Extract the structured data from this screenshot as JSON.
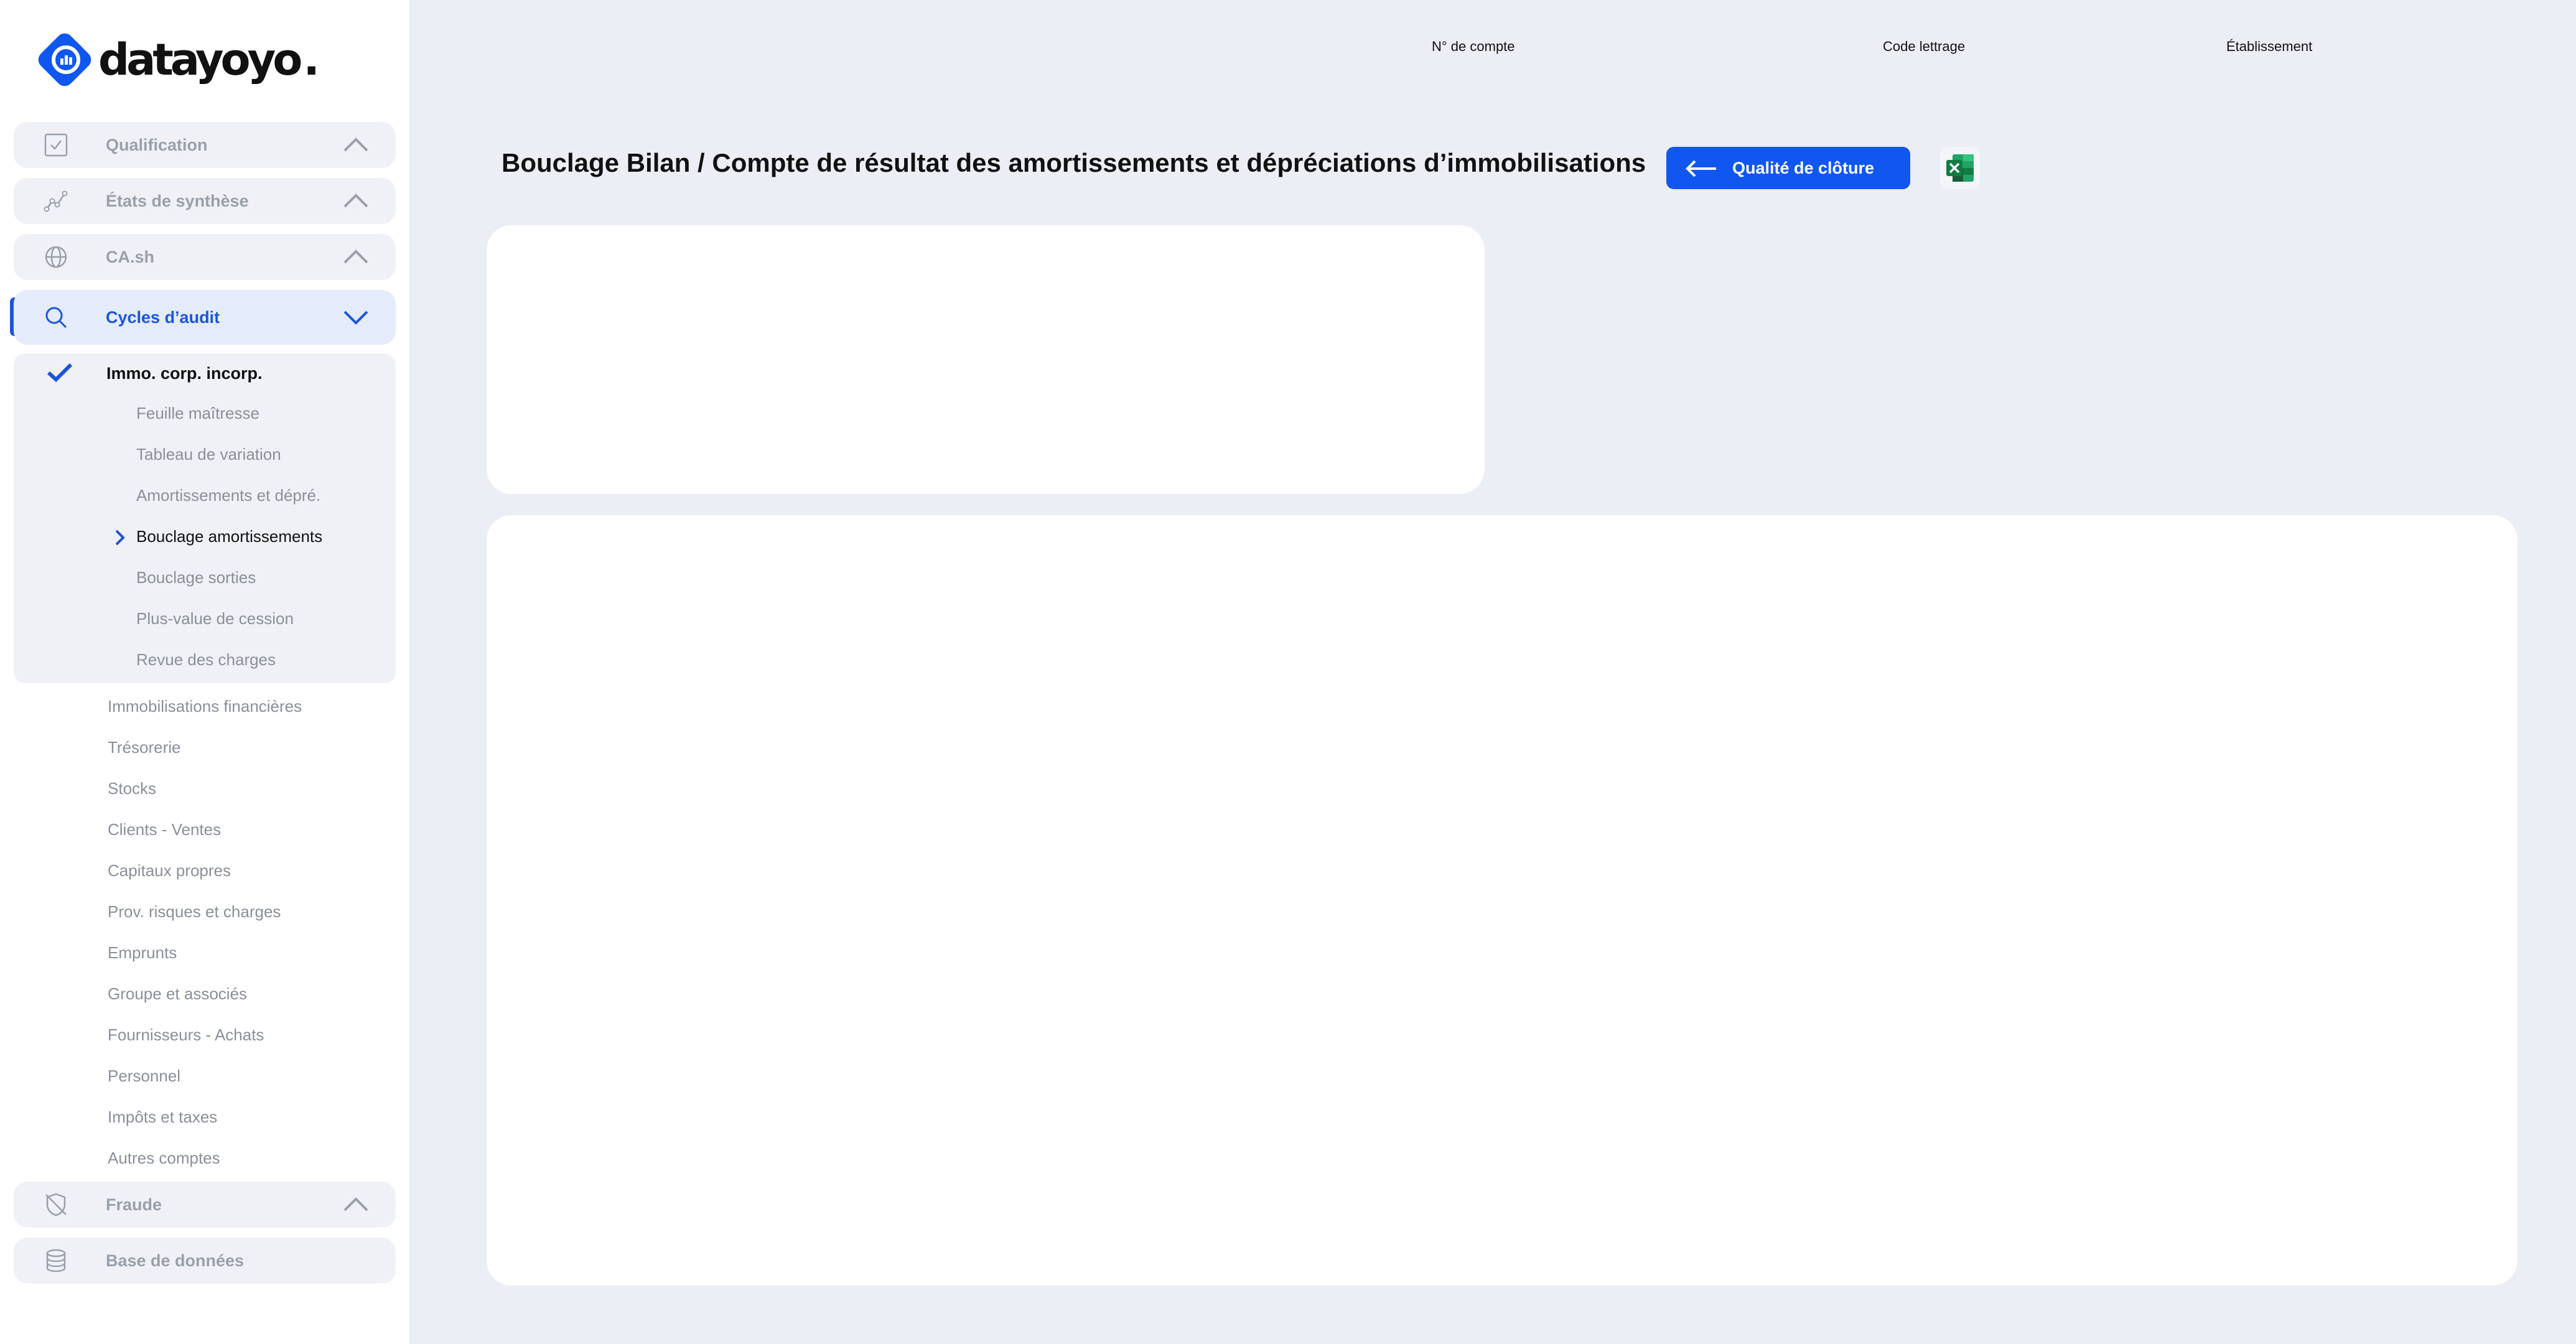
{
  "logo": {
    "text": "datayoyo"
  },
  "sections": {
    "qualification": {
      "label": "Qualification",
      "icon": "checkbox-icon"
    },
    "etats": {
      "label": "États de synthèse",
      "icon": "line-chart-icon"
    },
    "cash": {
      "label": "CA.sh",
      "icon": "globe-icon"
    },
    "cycles": {
      "label": "Cycles d’audit",
      "icon": "search-icon"
    },
    "fraude": {
      "label": "Fraude",
      "icon": "shield-off-icon"
    },
    "base": {
      "label": "Base de données",
      "icon": "database-icon"
    }
  },
  "current_cycle": {
    "title": "Immo. corp. incorp.",
    "items": [
      "Feuille maîtresse",
      "Tableau de variation",
      "Amortissements et dépré.",
      "Bouclage amortissements",
      "Bouclage sorties",
      "Plus-value de cession",
      "Revue des charges"
    ],
    "selected": "Bouclage amortissements"
  },
  "other_cycles": [
    "Immobilisations financières",
    "Trésorerie",
    "Stocks",
    "Clients - Ventes",
    "Capitaux propres",
    "Prov. risques et charges",
    "Emprunts",
    "Groupe et associés",
    "Fournisseurs - Achats",
    "Personnel",
    "Impôts et taxes",
    "Autres comptes"
  ],
  "header": {
    "col1": "N° de compte",
    "col2": "Code lettrage",
    "col3": "Établissement"
  },
  "page": {
    "title": "Bouclage Bilan / Compte de résultat des amortissements et dépréciations d’immobilisations",
    "quality_button": "Qualité de clôture",
    "export_icon": "excel-icon"
  },
  "colors": {
    "accent": "#1057f2",
    "active_nav": "#1d55d8",
    "background": "#eceef5"
  }
}
